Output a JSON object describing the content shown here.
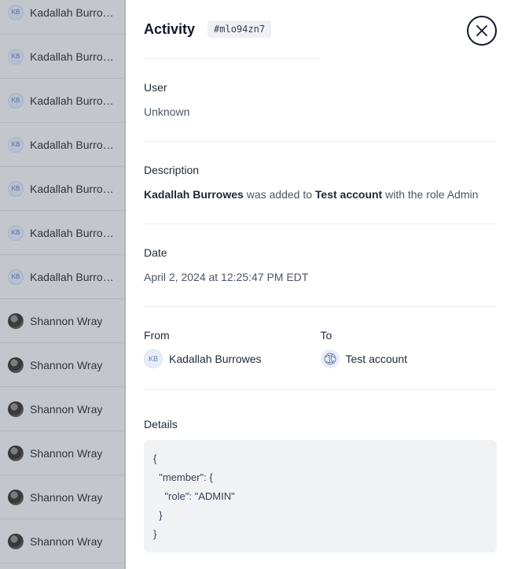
{
  "background_list": {
    "rows": [
      {
        "name": "Kadallah Burrowes",
        "avatar": "KB",
        "type": "initials"
      },
      {
        "name": "Kadallah Burrowes",
        "avatar": "KB",
        "type": "initials"
      },
      {
        "name": "Kadallah Burrowes",
        "avatar": "KB",
        "type": "initials"
      },
      {
        "name": "Kadallah Burrowes",
        "avatar": "KB",
        "type": "initials"
      },
      {
        "name": "Kadallah Burrowes",
        "avatar": "KB",
        "type": "initials"
      },
      {
        "name": "Kadallah Burrowes",
        "avatar": "KB",
        "type": "initials"
      },
      {
        "name": "Kadallah Burrowes",
        "avatar": "KB",
        "type": "initials"
      },
      {
        "name": "Shannon Wray",
        "avatar": "",
        "type": "photo"
      },
      {
        "name": "Shannon Wray",
        "avatar": "",
        "type": "photo"
      },
      {
        "name": "Shannon Wray",
        "avatar": "",
        "type": "photo"
      },
      {
        "name": "Shannon Wray",
        "avatar": "",
        "type": "photo"
      },
      {
        "name": "Shannon Wray",
        "avatar": "",
        "type": "photo"
      },
      {
        "name": "Shannon Wray",
        "avatar": "",
        "type": "photo"
      }
    ]
  },
  "panel": {
    "title": "Activity",
    "activity_id": "#mlo94zn7",
    "close_icon": "close-icon",
    "user": {
      "label": "User",
      "value": "Unknown"
    },
    "description": {
      "label": "Description",
      "actor": "Kadallah Burrowes",
      "text_1": " was added to ",
      "target": "Test account",
      "text_2": " with the role Admin"
    },
    "date": {
      "label": "Date",
      "value": "April 2, 2024 at 12:25:47 PM EDT"
    },
    "from": {
      "label": "From",
      "avatar": "KB",
      "name": "Kadallah Burrowes"
    },
    "to": {
      "label": "To",
      "icon": "account-logo-icon",
      "name": "Test account"
    },
    "details": {
      "label": "Details",
      "lines": [
        "{",
        "  \"member\": {",
        "    \"role\": \"ADMIN\"",
        "  }",
        "}"
      ]
    }
  }
}
